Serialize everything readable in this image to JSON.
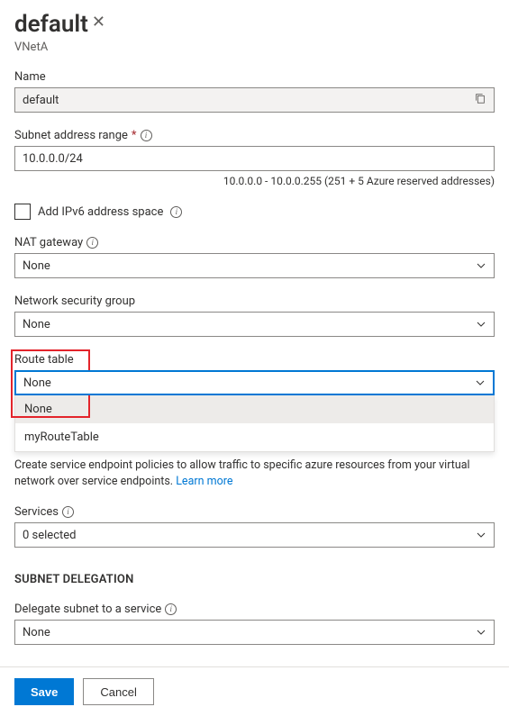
{
  "header": {
    "title": "default",
    "subtitle": "VNetA"
  },
  "name": {
    "label": "Name",
    "value": "default"
  },
  "subnetRange": {
    "label": "Subnet address range",
    "value": "10.0.0.0/24",
    "hint": "10.0.0.0 - 10.0.0.255 (251 + 5 Azure reserved addresses)"
  },
  "ipv6": {
    "label": "Add IPv6 address space"
  },
  "natGateway": {
    "label": "NAT gateway",
    "value": "None"
  },
  "nsg": {
    "label": "Network security group",
    "value": "None"
  },
  "routeTable": {
    "label": "Route table",
    "value": "None",
    "options": [
      "None",
      "myRouteTable"
    ]
  },
  "serviceEndpoints": {
    "help": "Create service endpoint policies to allow traffic to specific azure resources from your virtual network over service endpoints.",
    "learnMore": "Learn more"
  },
  "services": {
    "label": "Services",
    "value": "0 selected"
  },
  "delegation": {
    "sectionTitle": "SUBNET DELEGATION",
    "label": "Delegate subnet to a service",
    "value": "None"
  },
  "footer": {
    "save": "Save",
    "cancel": "Cancel"
  }
}
